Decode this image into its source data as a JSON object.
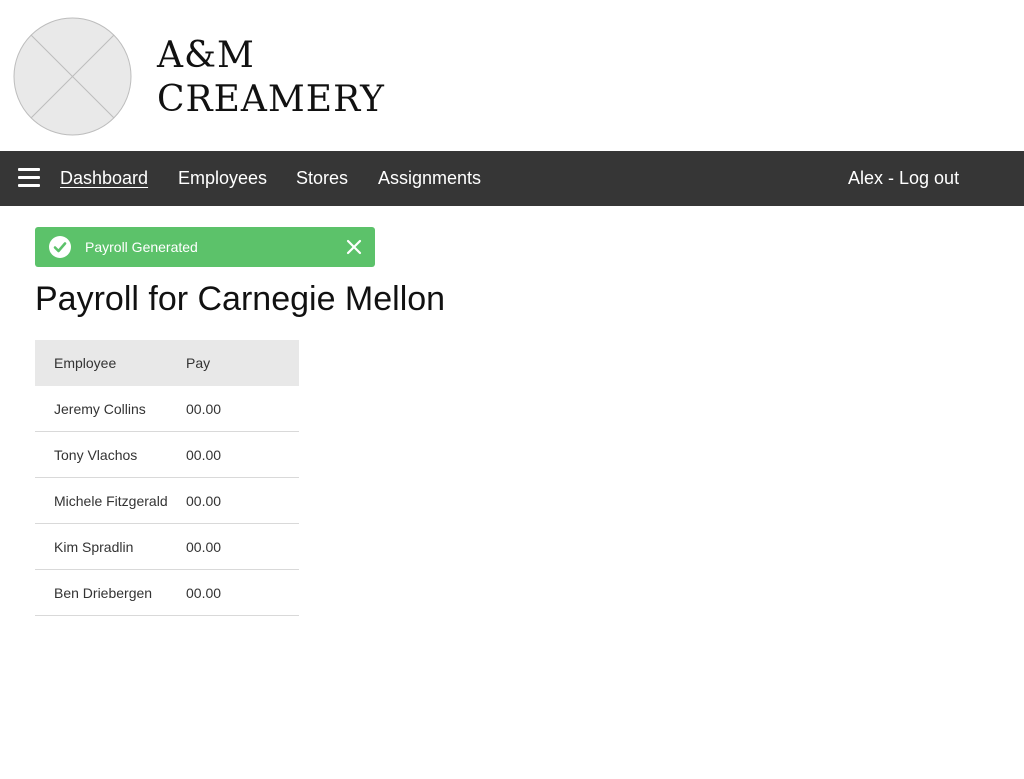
{
  "brand": {
    "line1": "A&M",
    "line2": "CREAMERY",
    "logo_icon": "image-placeholder-icon"
  },
  "nav": {
    "menu_icon": "hamburger-menu-icon",
    "items": [
      {
        "label": "Dashboard",
        "active": true
      },
      {
        "label": "Employees",
        "active": false
      },
      {
        "label": "Stores",
        "active": false
      },
      {
        "label": "Assignments",
        "active": false
      }
    ],
    "user_label": "Alex - Log out",
    "background_color": "#363636"
  },
  "alert": {
    "message": "Payroll Generated",
    "status_icon": "check-circle-icon",
    "close_icon": "close-icon",
    "color": "#5cc26a"
  },
  "page": {
    "title": "Payroll for Carnegie Mellon"
  },
  "payroll_table": {
    "headers": [
      "Employee",
      "Pay"
    ],
    "rows": [
      [
        "Jeremy Collins",
        "00.00"
      ],
      [
        "Tony Vlachos",
        "00.00"
      ],
      [
        "Michele Fitzgerald",
        "00.00"
      ],
      [
        "Kim Spradlin",
        "00.00"
      ],
      [
        "Ben Driebergen",
        "00.00"
      ]
    ]
  }
}
